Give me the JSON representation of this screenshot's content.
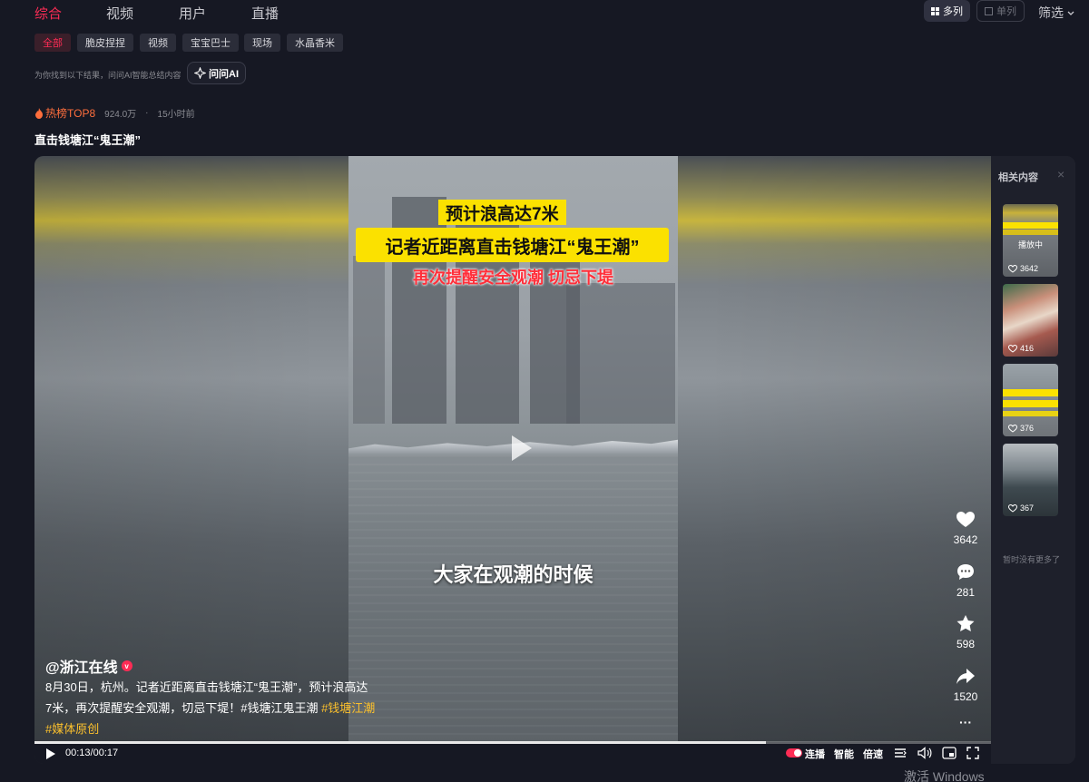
{
  "tabs": [
    "综合",
    "视频",
    "用户",
    "直播"
  ],
  "view": {
    "multi": "多列",
    "single": "单列"
  },
  "filter_label": "筛选",
  "chips": [
    "全部",
    "脆皮捏捏",
    "视频",
    "宝宝巴士",
    "现场",
    "水晶香米"
  ],
  "ai": {
    "note": "为你找到以下结果，问问AI智能总结内容",
    "button": "问问AI"
  },
  "hot": {
    "tag": "热榜TOP8",
    "views": "924.0万",
    "sep": "·",
    "time": "15小时前"
  },
  "video": {
    "title": "直击钱塘江“鬼王潮”",
    "caption_1": "预计浪高达7米",
    "caption_2": "记者近距离直击钱塘江“鬼王潮”",
    "caption_3": "再次提醒安全观潮 切忌下堤",
    "subtitle": "大家在观潮的时候",
    "author": "@浙江在线",
    "desc_line1": "8月30日，杭州。记者近距离直击钱塘江“鬼王潮”，预计浪高达",
    "desc_line2_plain": "7米，再次提醒安全观潮，切忌下堤！#钱塘江鬼王潮 ",
    "desc_hash1": "#钱塘江潮",
    "desc_hash2": "#媒体原创",
    "progress": 0.765,
    "time": "00:13/00:17",
    "actions": {
      "likes": "3642",
      "comments": "281",
      "favorites": "598",
      "shares": "1520",
      "more": "···"
    },
    "controls": {
      "autoplay": "连播",
      "smart": "智能",
      "speed": "倍速"
    }
  },
  "related": {
    "title": "相关内容",
    "close": "×",
    "items": [
      {
        "likes": "3642",
        "playing": "播放中"
      },
      {
        "likes": "416"
      },
      {
        "likes": "376"
      },
      {
        "likes": "367"
      }
    ],
    "end_note": "暂时没有更多了"
  },
  "os_watermark": "激活 Windows",
  "colors": {
    "accent": "#fe2c55",
    "bg": "#161823",
    "caption_yellow": "#fbe100",
    "hashtag": "#fbc02d"
  }
}
